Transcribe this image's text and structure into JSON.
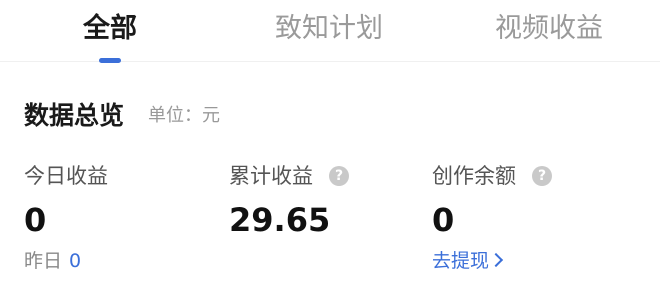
{
  "tabs": [
    {
      "label": "全部",
      "active": true
    },
    {
      "label": "致知计划",
      "active": false
    },
    {
      "label": "视频收益",
      "active": false
    }
  ],
  "overview": {
    "title": "数据总览",
    "unit": "单位：元"
  },
  "stats": [
    {
      "label": "今日收益",
      "value": "0"
    },
    {
      "label": "累计收益",
      "value": "29.65",
      "help_icon": "?"
    },
    {
      "label": "创作余额",
      "value": "0",
      "help_icon": "?"
    }
  ],
  "yesterday": {
    "label": "昨日",
    "value": "0"
  },
  "withdraw": {
    "label": "去提现"
  },
  "colors": {
    "accent": "#3b6fd9",
    "inactive_tab": "#9a9a9a",
    "help_icon_bg": "#c9c9c9"
  }
}
